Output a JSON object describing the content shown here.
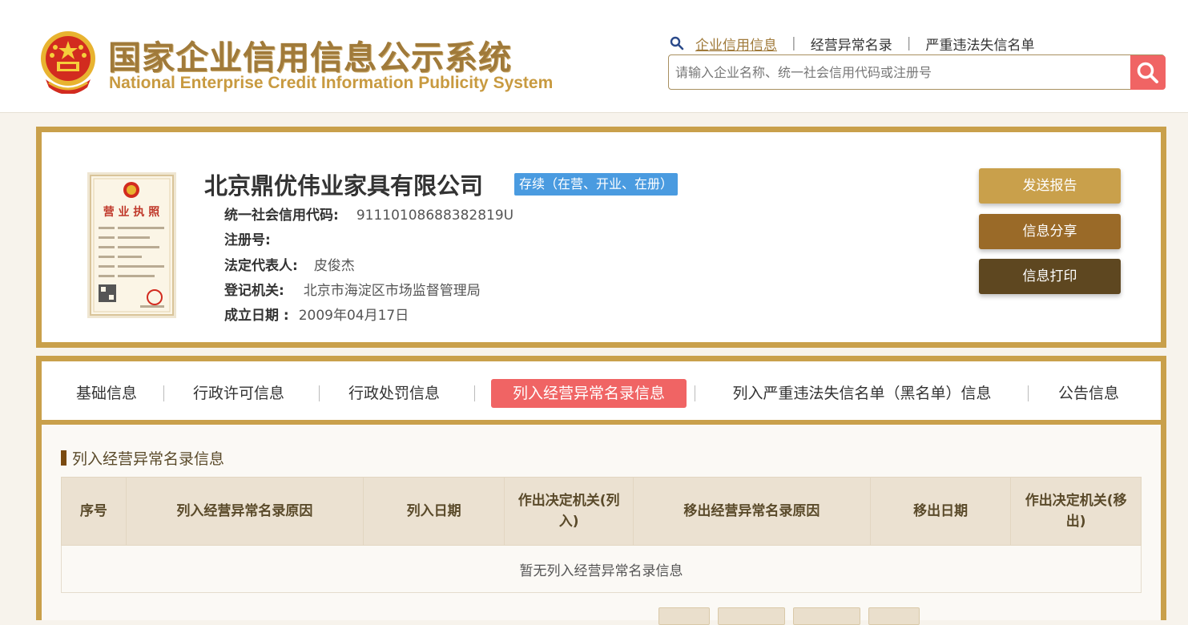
{
  "header": {
    "title_cn": "国家企业信用信息公示系统",
    "title_en": "National Enterprise Credit Information Publicity System",
    "nav": [
      {
        "label": "企业信用信息",
        "active": true
      },
      {
        "label": "经营异常名录",
        "active": false
      },
      {
        "label": "严重违法失信名单",
        "active": false
      }
    ],
    "search_placeholder": "请输入企业名称、统一社会信用代码或注册号"
  },
  "company": {
    "name": "北京鼎优伟业家具有限公司",
    "status": "存续（在营、开业、在册）",
    "fields": [
      {
        "label": "统一社会信用代码:",
        "value": "91110108688382819U"
      },
      {
        "label": "注册号:",
        "value": ""
      },
      {
        "label": "法定代表人:",
        "value": "皮俊杰"
      },
      {
        "label": "登记机关:",
        "value": "北京市海淀区市场监督管理局"
      },
      {
        "label": "成立日期 :",
        "value": "2009年04月17日"
      }
    ],
    "license_caption": "营 业 执 照",
    "actions": [
      {
        "label": "发送报告",
        "color": "#c9a04b"
      },
      {
        "label": "信息分享",
        "color": "#9a6a28"
      },
      {
        "label": "信息打印",
        "color": "#5e4720"
      }
    ]
  },
  "tabs": [
    {
      "label": "基础信息",
      "active": false
    },
    {
      "label": "行政许可信息",
      "active": false
    },
    {
      "label": "行政处罚信息",
      "active": false
    },
    {
      "label": "列入经营异常名录信息",
      "active": true
    },
    {
      "label": "列入严重违法失信名单（黑名单）信息",
      "active": false
    },
    {
      "label": "公告信息",
      "active": false
    }
  ],
  "section": {
    "title": "列入经营异常名录信息",
    "columns": [
      "序号",
      "列入经营异常名录原因",
      "列入日期",
      "作出决定机关(列入)",
      "移出经营异常名录原因",
      "移出日期",
      "作出决定机关(移出)"
    ],
    "empty_message": "暂无列入经营异常名录信息"
  },
  "colors": {
    "accent_gold": "#c9a04b",
    "active_tab": "#f06464",
    "status_badge": "#4a9be0"
  }
}
